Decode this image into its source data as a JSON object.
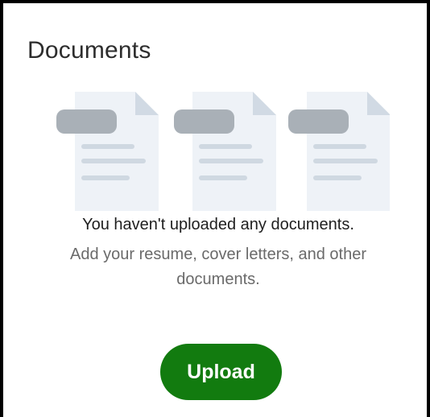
{
  "card": {
    "title": "Documents"
  },
  "empty_state": {
    "message": "You haven't uploaded any documents.",
    "hint": "Add your resume, cover letters, and other documents."
  },
  "actions": {
    "upload_label": "Upload"
  },
  "colors": {
    "accent": "#127b0f",
    "doc_page": "#eef2f7",
    "doc_fold": "#d1dae4",
    "doc_tab": "#a9b0b7",
    "doc_lines": "#cfd8e1"
  },
  "illustration": {
    "doc_icons": [
      "document-icon",
      "document-icon",
      "document-icon"
    ]
  }
}
